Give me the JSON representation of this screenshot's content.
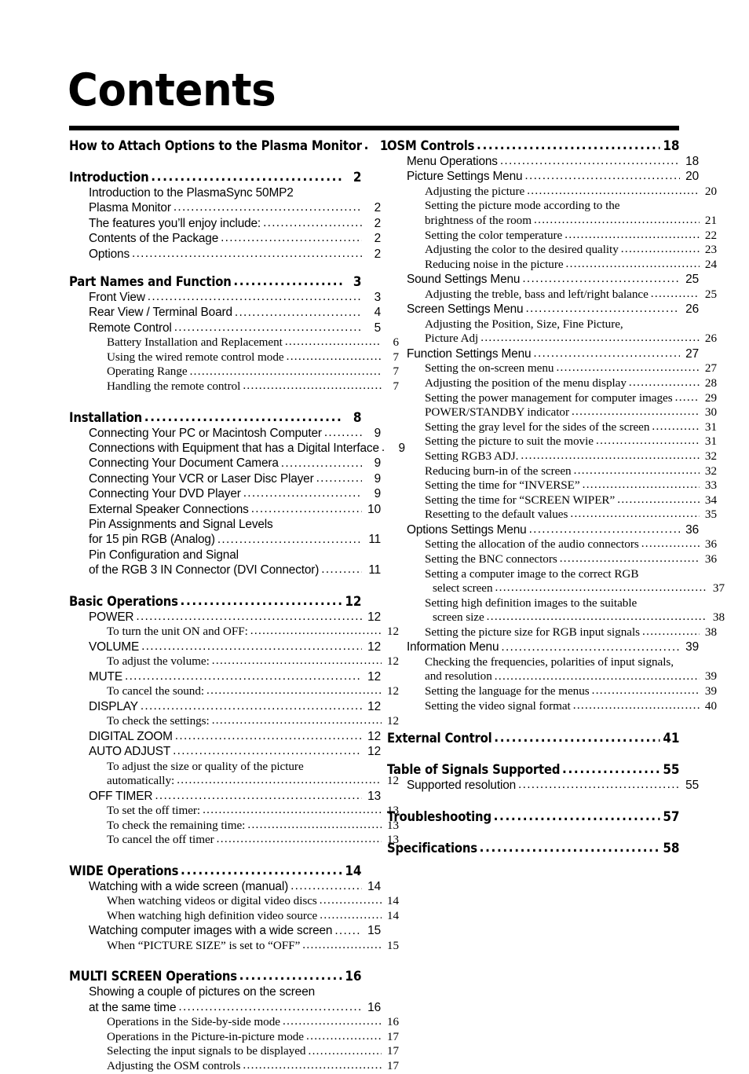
{
  "document": {
    "title": "Contents"
  },
  "left_column": [
    {
      "level": 1,
      "label": "How to Attach Options to the Plasma Monitor",
      "page": "1",
      "gap_before": 0
    },
    {
      "level": 1,
      "label": "Introduction",
      "page": "2",
      "gap_before": 20
    },
    {
      "level": 2,
      "label": "Introduction to the PlasmaSync 50MP2",
      "page": "",
      "wrap": "first"
    },
    {
      "level": 2,
      "label": "Plasma Monitor",
      "page": "2",
      "wrap": "last"
    },
    {
      "level": 2,
      "label": "The features you’ll enjoy include:",
      "page": "2"
    },
    {
      "level": 2,
      "label": "Contents of the Package",
      "page": "2"
    },
    {
      "level": 2,
      "label": "Options",
      "page": "2"
    },
    {
      "level": 1,
      "label": "Part Names and Function",
      "page": "3",
      "gap_before": 16
    },
    {
      "level": 2,
      "label": "Front View",
      "page": "3"
    },
    {
      "level": 2,
      "label": "Rear View / Terminal Board",
      "page": "4"
    },
    {
      "level": 2,
      "label": "Remote Control",
      "page": "5"
    },
    {
      "level": 3,
      "label": "Battery Installation and Replacement",
      "page": "6"
    },
    {
      "level": 3,
      "label": "Using the wired remote control mode",
      "page": "7"
    },
    {
      "level": 3,
      "label": "Operating Range",
      "page": "7"
    },
    {
      "level": 3,
      "label": "Handling the remote control",
      "page": "7"
    },
    {
      "level": 1,
      "label": "Installation",
      "page": "8",
      "gap_before": 20
    },
    {
      "level": 2,
      "label": "Connecting Your PC or Macintosh Computer",
      "page": "9"
    },
    {
      "level": 2,
      "label": "Connections with Equipment that has a Digital Interface",
      "page": "9"
    },
    {
      "level": 2,
      "label": "Connecting Your Document Camera",
      "page": "9"
    },
    {
      "level": 2,
      "label": "Connecting Your VCR or Laser Disc Player",
      "page": "9"
    },
    {
      "level": 2,
      "label": "Connecting Your DVD Player",
      "page": "9"
    },
    {
      "level": 2,
      "label": "External Speaker Connections",
      "page": "10"
    },
    {
      "level": 2,
      "label": "Pin Assignments and Signal Levels",
      "page": "",
      "wrap": "first"
    },
    {
      "level": 2,
      "label": "for 15 pin RGB (Analog)",
      "page": "11",
      "wrap": "last"
    },
    {
      "level": 2,
      "label": "Pin Configuration and Signal",
      "page": "",
      "wrap": "first"
    },
    {
      "level": 2,
      "label": "of the RGB 3 IN Connector (DVI Connector)",
      "page": "11",
      "wrap": "last"
    },
    {
      "level": 1,
      "label": "Basic Operations",
      "page": "12",
      "gap_before": 20
    },
    {
      "level": 2,
      "label": "POWER",
      "page": "12"
    },
    {
      "level": 3,
      "label": "To turn the unit ON and OFF:",
      "page": "12"
    },
    {
      "level": 2,
      "label": "VOLUME",
      "page": "12"
    },
    {
      "level": 3,
      "label": "To adjust the volume:",
      "page": "12"
    },
    {
      "level": 2,
      "label": "MUTE",
      "page": "12"
    },
    {
      "level": 3,
      "label": "To cancel the sound:",
      "page": "12"
    },
    {
      "level": 2,
      "label": "DISPLAY",
      "page": "12"
    },
    {
      "level": 3,
      "label": "To check the settings:",
      "page": "12"
    },
    {
      "level": 2,
      "label": "DIGITAL ZOOM",
      "page": "12"
    },
    {
      "level": 2,
      "label": "AUTO ADJUST",
      "page": "12"
    },
    {
      "level": 3,
      "label": "To adjust the size or quality of the picture",
      "page": "",
      "wrap": "first"
    },
    {
      "level": 3,
      "label": "automatically:",
      "page": "12",
      "wrap": "last"
    },
    {
      "level": 2,
      "label": "OFF TIMER",
      "page": "13"
    },
    {
      "level": 3,
      "label": "To set the off timer:",
      "page": "13"
    },
    {
      "level": 3,
      "label": "To check the remaining time:",
      "page": "13"
    },
    {
      "level": 3,
      "label": "To cancel the off timer",
      "page": "13"
    },
    {
      "level": 1,
      "label": "WIDE Operations",
      "page": "14",
      "gap_before": 20
    },
    {
      "level": 2,
      "label": "Watching with a wide screen (manual)",
      "page": "14"
    },
    {
      "level": 3,
      "label": "When watching videos or digital video discs",
      "page": "14"
    },
    {
      "level": 3,
      "label": "When watching high definition video source",
      "page": "14"
    },
    {
      "level": 2,
      "label": "Watching computer images with a wide screen",
      "page": "15"
    },
    {
      "level": 3,
      "label": "When “PICTURE SIZE” is set to “OFF”",
      "page": "15"
    },
    {
      "level": 1,
      "label": "MULTI SCREEN Operations",
      "page": "16",
      "gap_before": 20
    },
    {
      "level": 2,
      "label": "Showing a couple of pictures on the screen",
      "page": "",
      "wrap": "first"
    },
    {
      "level": 2,
      "label": "at the same time",
      "page": "16",
      "wrap": "last"
    },
    {
      "level": 3,
      "label": "Operations in the Side-by-side mode",
      "page": "16"
    },
    {
      "level": 3,
      "label": "Operations in the Picture-in-picture mode",
      "page": "17"
    },
    {
      "level": 3,
      "label": "Selecting the input signals to be displayed",
      "page": "17"
    },
    {
      "level": 3,
      "label": "Adjusting the OSM controls",
      "page": "17"
    }
  ],
  "right_column": [
    {
      "level": 1,
      "label": "OSM Controls",
      "page": "18",
      "gap_before": 0
    },
    {
      "level": 2,
      "label": "Menu Operations",
      "page": "18"
    },
    {
      "level": 2,
      "label": "Picture Settings Menu",
      "page": "20"
    },
    {
      "level": 3,
      "label": "Adjusting the picture",
      "page": "20"
    },
    {
      "level": 3,
      "label": "Setting the picture mode according to the",
      "page": "",
      "wrap": "first"
    },
    {
      "level": 3,
      "label": "brightness of the room",
      "page": "21",
      "wrap": "last"
    },
    {
      "level": 3,
      "label": "Setting the color temperature",
      "page": "22"
    },
    {
      "level": 3,
      "label": "Adjusting the color to the desired quality",
      "page": "23"
    },
    {
      "level": 3,
      "label": "Reducing noise in the picture",
      "page": "24"
    },
    {
      "level": 2,
      "label": "Sound Settings Menu",
      "page": "25"
    },
    {
      "level": 3,
      "label": "Adjusting the treble, bass and left/right balance",
      "page": "25"
    },
    {
      "level": 2,
      "label": "Screen Settings Menu",
      "page": "26"
    },
    {
      "level": 3,
      "label": "Adjusting the Position, Size, Fine Picture,",
      "page": "",
      "wrap": "first"
    },
    {
      "level": 3,
      "label": "Picture Adj",
      "page": "26",
      "wrap": "last"
    },
    {
      "level": 2,
      "label": "Function Settings Menu",
      "page": "27"
    },
    {
      "level": 3,
      "label": "Setting the on-screen menu",
      "page": "27"
    },
    {
      "level": 3,
      "label": "Adjusting the position of the menu display",
      "page": "28"
    },
    {
      "level": 3,
      "label": "Setting the power management for computer images",
      "page": "29"
    },
    {
      "level": 3,
      "label": "POWER/STANDBY indicator",
      "page": "30"
    },
    {
      "level": 3,
      "label": "Setting the gray level for the sides of the screen",
      "page": "31"
    },
    {
      "level": 3,
      "label": "Setting the picture to suit the movie",
      "page": "31"
    },
    {
      "level": 3,
      "label": "Setting RGB3 ADJ.",
      "page": "32"
    },
    {
      "level": 3,
      "label": "Reducing burn-in of the screen",
      "page": "32"
    },
    {
      "level": 3,
      "label": "Setting the time for “INVERSE”",
      "page": "33"
    },
    {
      "level": 3,
      "label": "Setting the time for “SCREEN WIPER”",
      "page": "34"
    },
    {
      "level": 3,
      "label": "Resetting to the default values",
      "page": "35"
    },
    {
      "level": 2,
      "label": "Options Settings Menu",
      "page": "36"
    },
    {
      "level": 3,
      "label": "Setting the allocation of the audio connectors",
      "page": "36"
    },
    {
      "level": 3,
      "label": "Setting the BNC connectors",
      "page": "36"
    },
    {
      "level": 3,
      "label": "Setting a computer image to the correct RGB",
      "page": "",
      "wrap": "first"
    },
    {
      "level": 3,
      "label": "select screen",
      "page": "37",
      "wrap": "last",
      "indent": true
    },
    {
      "level": 3,
      "label": "Setting high definition images to the suitable",
      "page": "",
      "wrap": "first"
    },
    {
      "level": 3,
      "label": "screen size",
      "page": "38",
      "wrap": "last",
      "indent": true
    },
    {
      "level": 3,
      "label": "Setting the picture size for RGB input signals",
      "page": "38"
    },
    {
      "level": 2,
      "label": "Information Menu",
      "page": "39"
    },
    {
      "level": 3,
      "label": "Checking the frequencies, polarities of input signals,",
      "page": "",
      "wrap": "first"
    },
    {
      "level": 3,
      "label": "and resolution",
      "page": "39",
      "wrap": "last"
    },
    {
      "level": 3,
      "label": "Setting the language for the menus",
      "page": "39"
    },
    {
      "level": 3,
      "label": "Setting the video signal format",
      "page": "40"
    },
    {
      "level": 1,
      "label": "External Control",
      "page": "41",
      "gap_before": 22
    },
    {
      "level": 1,
      "label": "Table of Signals Supported",
      "page": "55",
      "gap_before": 20
    },
    {
      "level": 2,
      "label": "Supported resolution",
      "page": "55"
    },
    {
      "level": 1,
      "label": "Troubleshooting",
      "page": "57",
      "gap_before": 20
    },
    {
      "level": 1,
      "label": "Specifications",
      "page": "58",
      "gap_before": 20
    }
  ]
}
